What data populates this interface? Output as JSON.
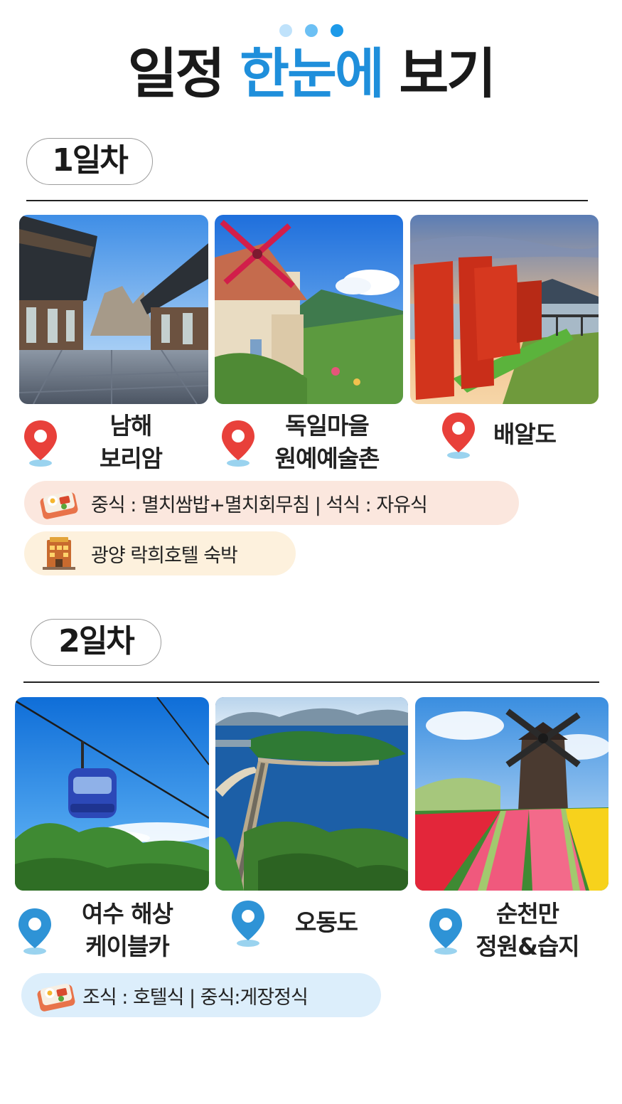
{
  "header": {
    "title_part1": "일정",
    "title_accent": "한눈에",
    "title_part2": "보기",
    "accent_color": "#1f8fdb"
  },
  "days": [
    {
      "label": "1일차",
      "places": [
        {
          "name_line1": "남해",
          "name_line2": "보리암",
          "photo": "temple-courtyard"
        },
        {
          "name_line1": "독일마을",
          "name_line2": "원예예술촌",
          "photo": "windmill-house"
        },
        {
          "name_line1": "배알도",
          "name_line2": "",
          "photo": "baealdo-sign"
        }
      ],
      "pin_color": "#e8403a",
      "meals": "중식 : 멸치쌈밥+멸치회무침 |  석식 : 자유식",
      "meals_icon": "bento-icon",
      "meals_bar_color": "#fbe7de",
      "lodging": "광양 락희호텔 숙박",
      "lodging_icon": "hotel-icon",
      "lodging_bar_color": "#fdf1dd"
    },
    {
      "label": "2일차",
      "places": [
        {
          "name_line1": "여수 해상",
          "name_line2": "케이블카",
          "photo": "cable-car"
        },
        {
          "name_line1": "오동도",
          "name_line2": "",
          "photo": "island-causeway"
        },
        {
          "name_line1": "순천만",
          "name_line2": "정원&습지",
          "photo": "tulip-windmill"
        }
      ],
      "pin_color": "#2e93d6",
      "meals": "조식 : 호텔식 |  중식:게장정식",
      "meals_icon": "bento-icon",
      "meals_bar_color": "#dceefb"
    }
  ]
}
